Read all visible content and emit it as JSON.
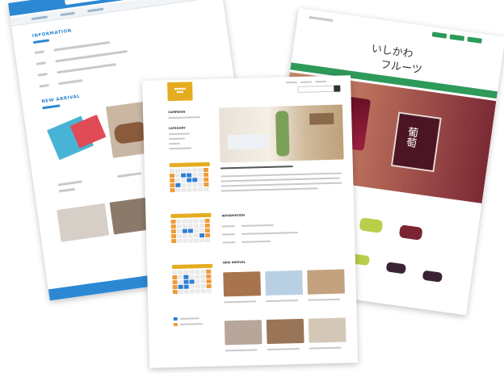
{
  "left_page": {
    "header": {
      "brand": "",
      "nav": [
        "",
        "",
        ""
      ]
    },
    "information_title": "INFORMATION",
    "new_arrival_title": "NEW ARRIVAL"
  },
  "right_page": {
    "logo_text": "いしかわ",
    "logo_sub": "フルーツ",
    "card_text": "葡萄"
  },
  "center_page": {
    "campaign_title": "CAMPAIGN",
    "category_title": "CATEGORY",
    "information_title": "INFORMATION",
    "new_arrival_title": "NEW ARRIVAL"
  },
  "colors": {
    "blue": "#2c88d3",
    "gold": "#e5ac1f",
    "green": "#2e9a5a",
    "orange": "#ef9b39"
  }
}
